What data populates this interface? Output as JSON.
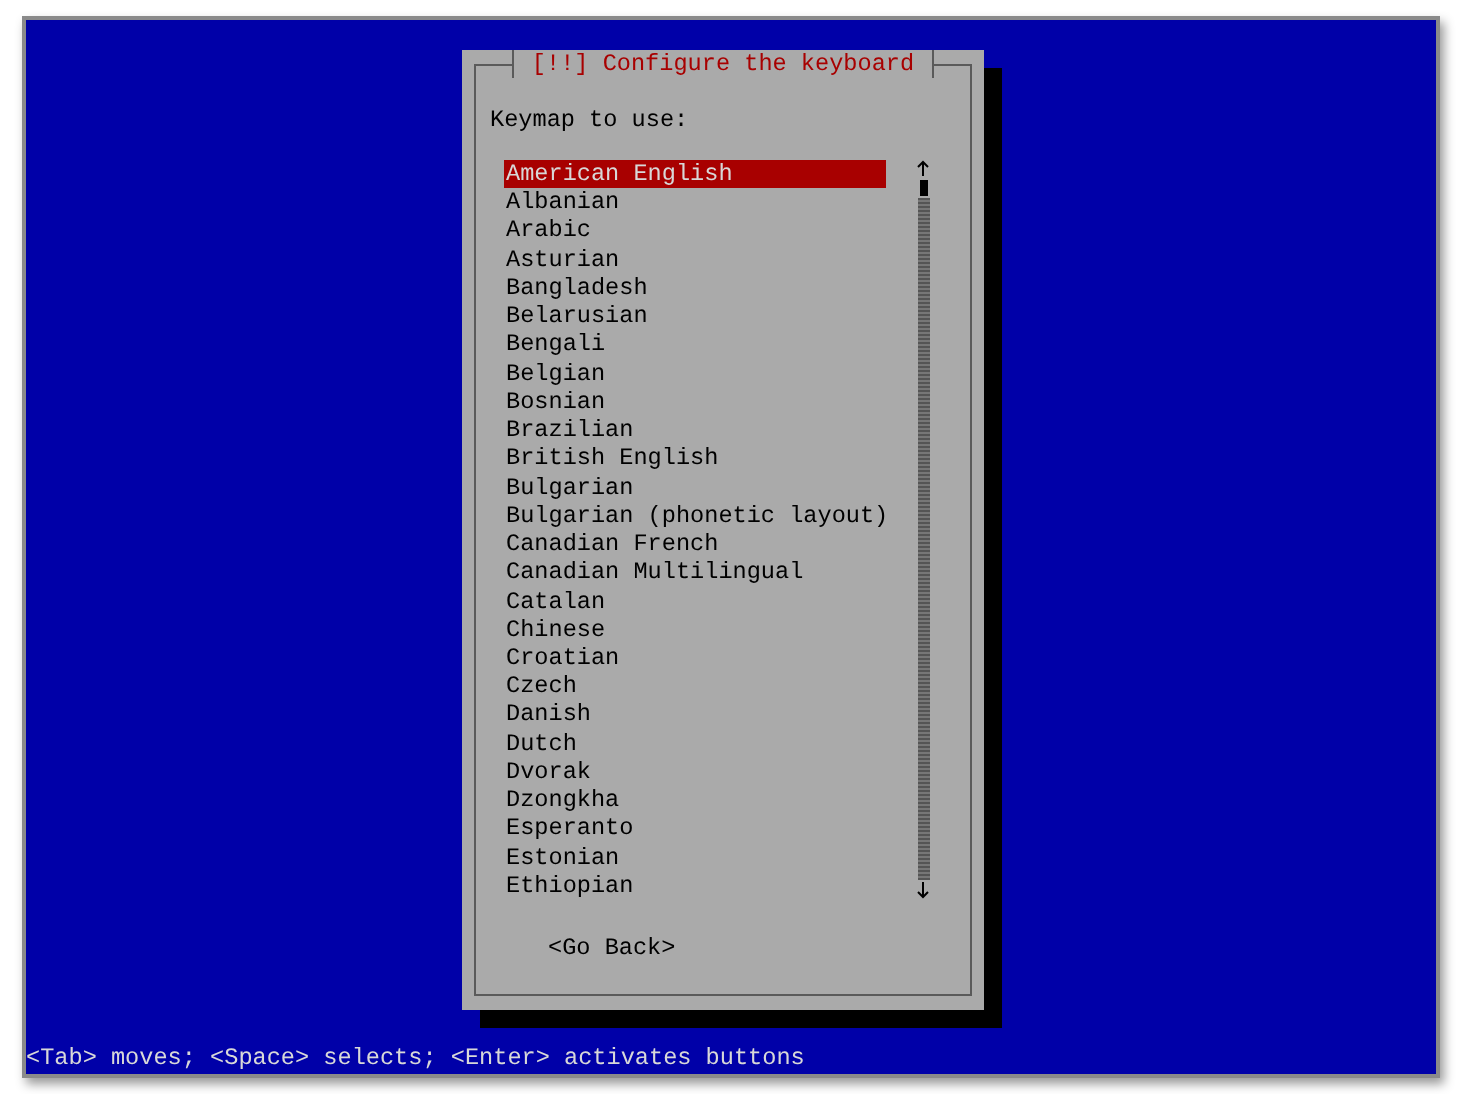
{
  "dialog": {
    "title": "[!!] Configure the keyboard",
    "prompt": "Keymap to use:",
    "keymaps": [
      {
        "label": "American English",
        "selected": true
      },
      {
        "label": "Albanian",
        "selected": false
      },
      {
        "label": "Arabic",
        "selected": false
      },
      {
        "label": "Asturian",
        "selected": false
      },
      {
        "label": "Bangladesh",
        "selected": false
      },
      {
        "label": "Belarusian",
        "selected": false
      },
      {
        "label": "Bengali",
        "selected": false
      },
      {
        "label": "Belgian",
        "selected": false
      },
      {
        "label": "Bosnian",
        "selected": false
      },
      {
        "label": "Brazilian",
        "selected": false
      },
      {
        "label": "British English",
        "selected": false
      },
      {
        "label": "Bulgarian",
        "selected": false
      },
      {
        "label": "Bulgarian (phonetic layout)",
        "selected": false
      },
      {
        "label": "Canadian French",
        "selected": false
      },
      {
        "label": "Canadian Multilingual",
        "selected": false
      },
      {
        "label": "Catalan",
        "selected": false
      },
      {
        "label": "Chinese",
        "selected": false
      },
      {
        "label": "Croatian",
        "selected": false
      },
      {
        "label": "Czech",
        "selected": false
      },
      {
        "label": "Danish",
        "selected": false
      },
      {
        "label": "Dutch",
        "selected": false
      },
      {
        "label": "Dvorak",
        "selected": false
      },
      {
        "label": "Dzongkha",
        "selected": false
      },
      {
        "label": "Esperanto",
        "selected": false
      },
      {
        "label": "Estonian",
        "selected": false
      },
      {
        "label": "Ethiopian",
        "selected": false
      }
    ],
    "buttons": [
      "<Go Back>"
    ]
  },
  "status_bar": "<Tab> moves; <Space> selects; <Enter> activates buttons"
}
